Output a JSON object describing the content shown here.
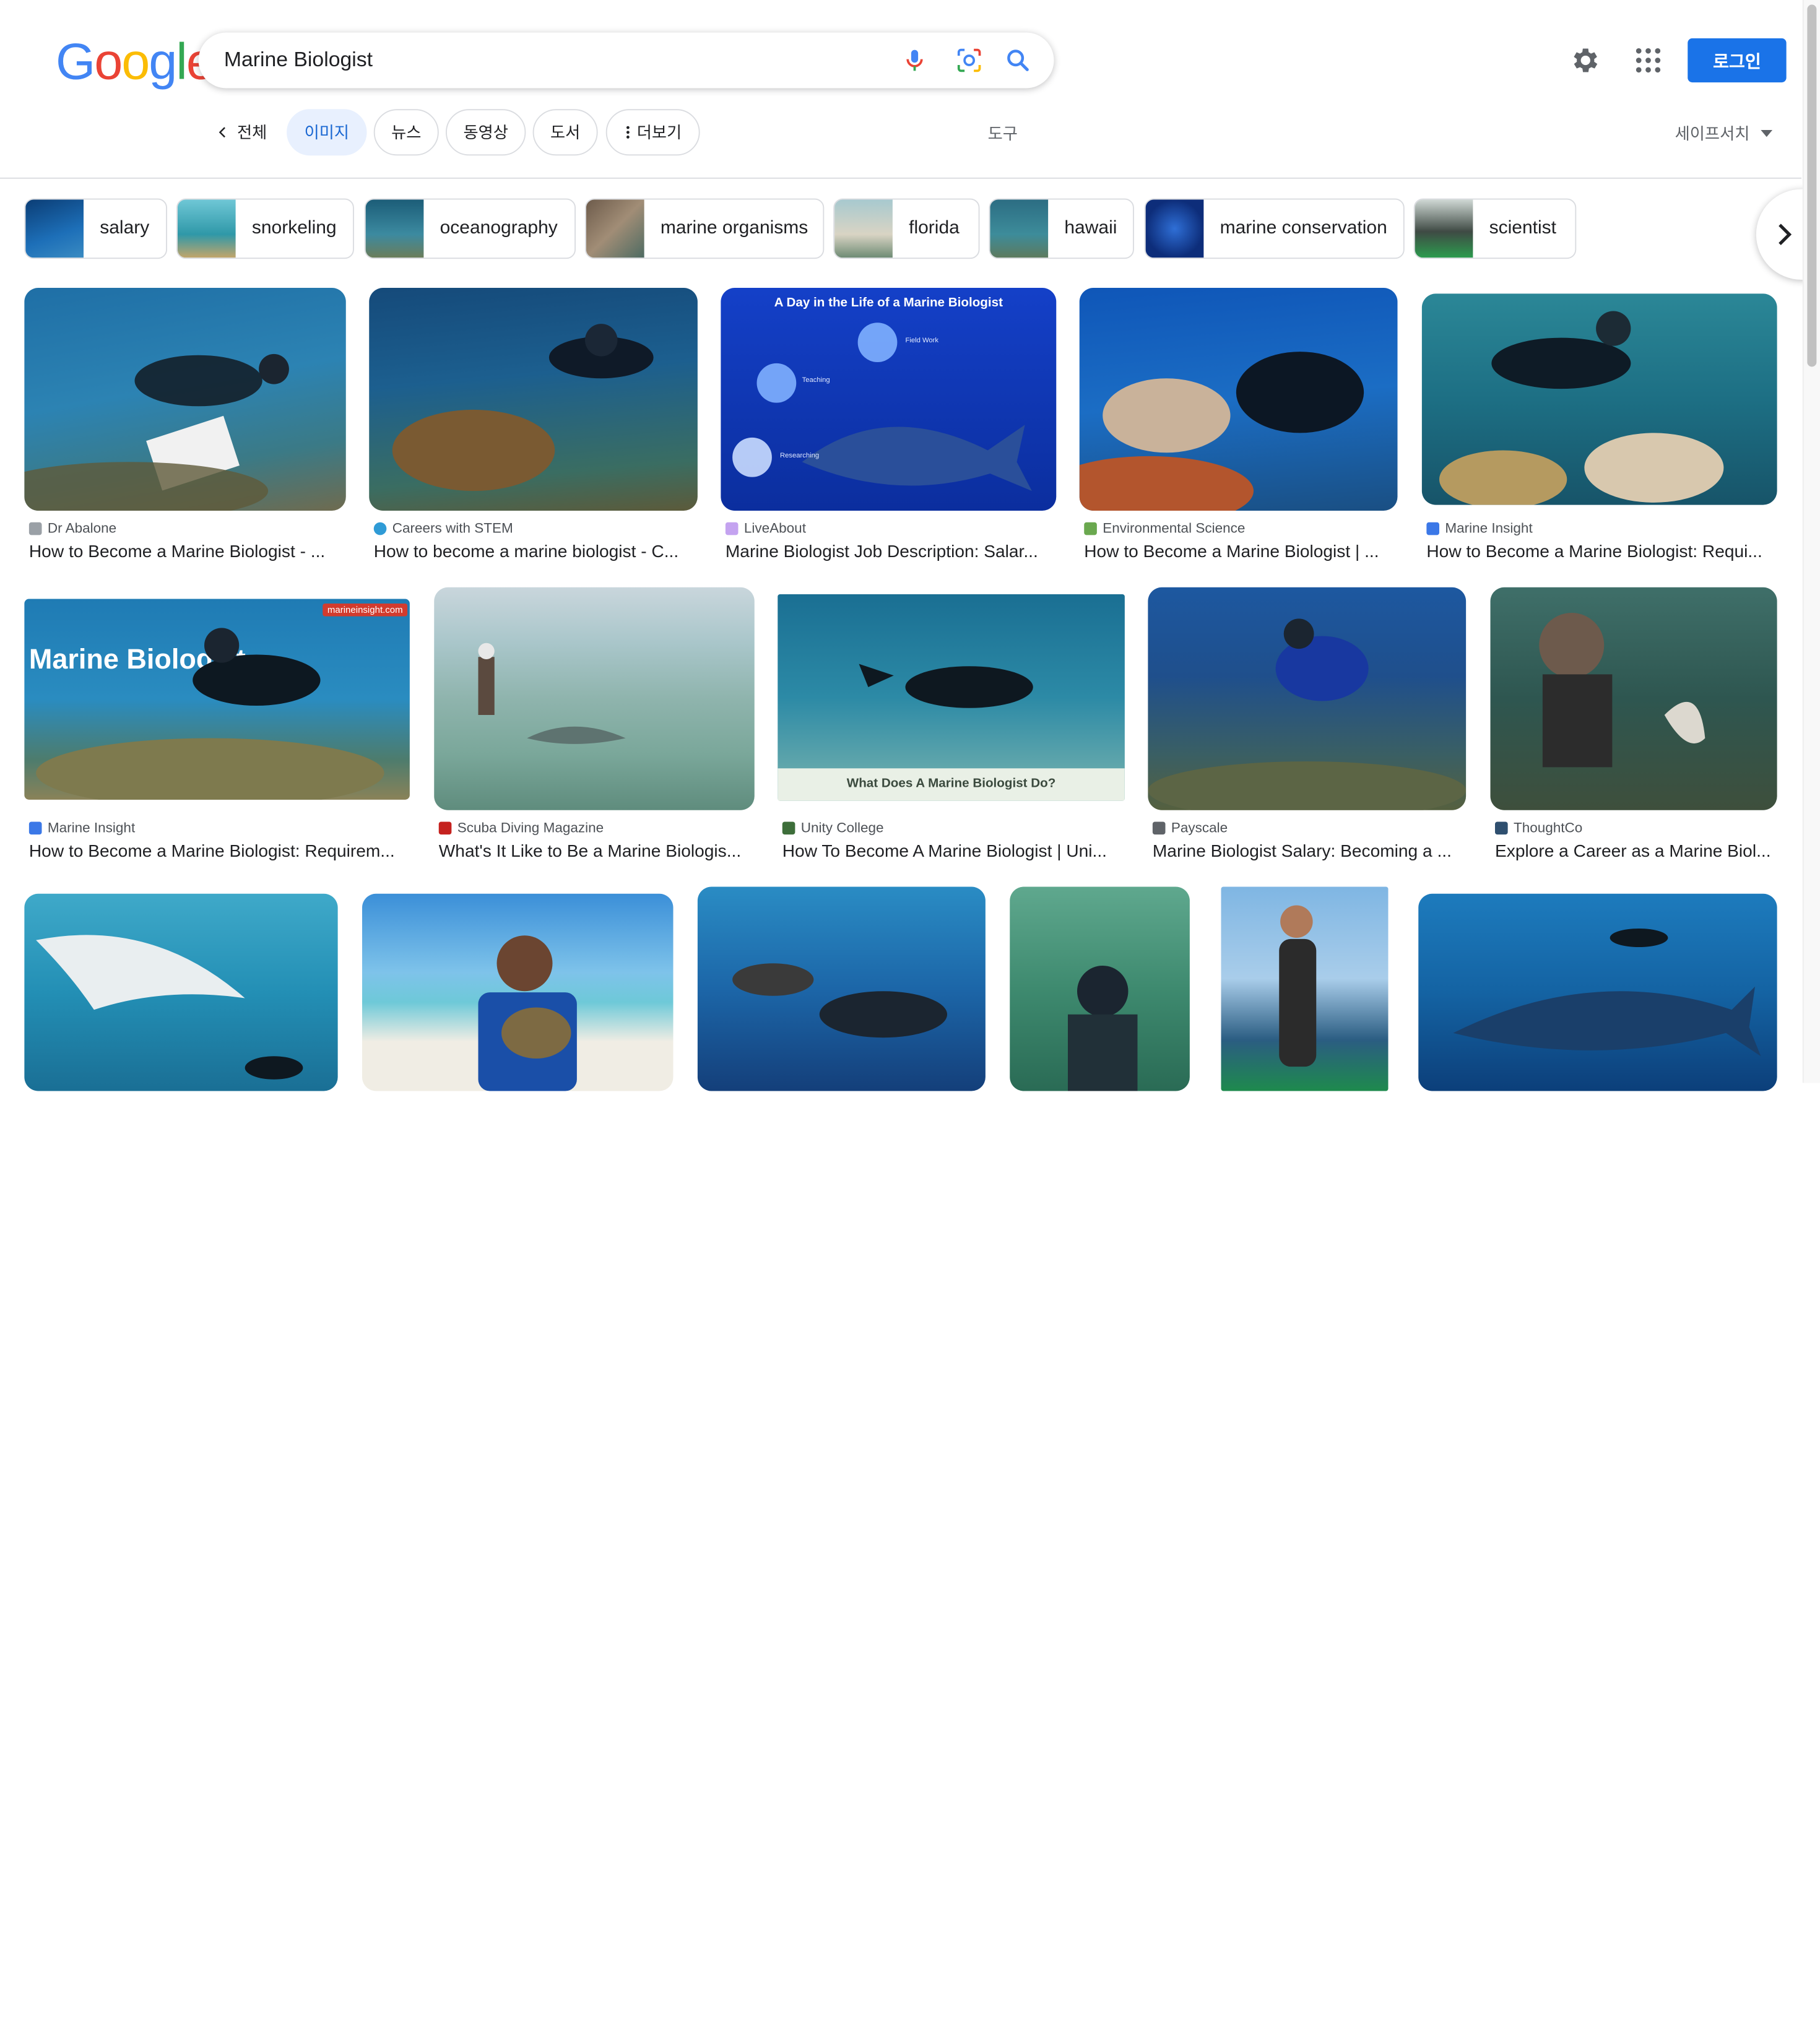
{
  "logo": {
    "text": "Google"
  },
  "search": {
    "query": "Marine Biologist"
  },
  "header": {
    "login_label": "로그인"
  },
  "tabs": [
    {
      "label": "전체"
    },
    {
      "label": "이미지"
    },
    {
      "label": "뉴스"
    },
    {
      "label": "동영상"
    },
    {
      "label": "도서"
    },
    {
      "label": "더보기"
    }
  ],
  "tools_label": "도구",
  "safesearch_label": "세이프서치",
  "chips": [
    {
      "label": "salary"
    },
    {
      "label": "snorkeling"
    },
    {
      "label": "oceanography"
    },
    {
      "label": "marine organisms"
    },
    {
      "label": "florida"
    },
    {
      "label": "hawaii"
    },
    {
      "label": "marine conservation"
    },
    {
      "label": "scientist"
    }
  ],
  "results_row1": [
    {
      "source": "Dr Abalone",
      "title": "How to Become a Marine Biologist - ..."
    },
    {
      "source": "Careers with STEM",
      "title": "How to become a marine biologist - C..."
    },
    {
      "source": "LiveAbout",
      "title": "Marine Biologist Job Description: Salar...",
      "image_text": "A Day in the Life of a Marine Biologist",
      "image_labels": [
        "Field Work",
        "Teaching",
        "Researching"
      ]
    },
    {
      "source": "Environmental Science",
      "title": "How to Become a Marine Biologist | ..."
    },
    {
      "source": "Marine Insight",
      "title": "How to Become a Marine Biologist: Requi..."
    }
  ],
  "results_row2": [
    {
      "source": "Marine Insight",
      "title": "How to Become a Marine Biologist: Requirem...",
      "image_text": "Marine Biologist",
      "image_site": "marineinsight.com"
    },
    {
      "source": "Scuba Diving Magazine",
      "title": "What's It Like to Be a Marine Biologis..."
    },
    {
      "source": "Unity College",
      "title": "How To Become A Marine Biologist | Uni...",
      "image_text": "What Does A Marine Biologist Do?"
    },
    {
      "source": "Payscale",
      "title": "Marine Biologist Salary: Becoming a ..."
    },
    {
      "source": "ThoughtCo",
      "title": "Explore a Career as a Marine Biol..."
    }
  ],
  "colors": {
    "accent": "#1a73e8",
    "tab_selected_bg": "#e8f0fe",
    "tab_selected_text": "#1967d2",
    "border": "#dadce0"
  }
}
